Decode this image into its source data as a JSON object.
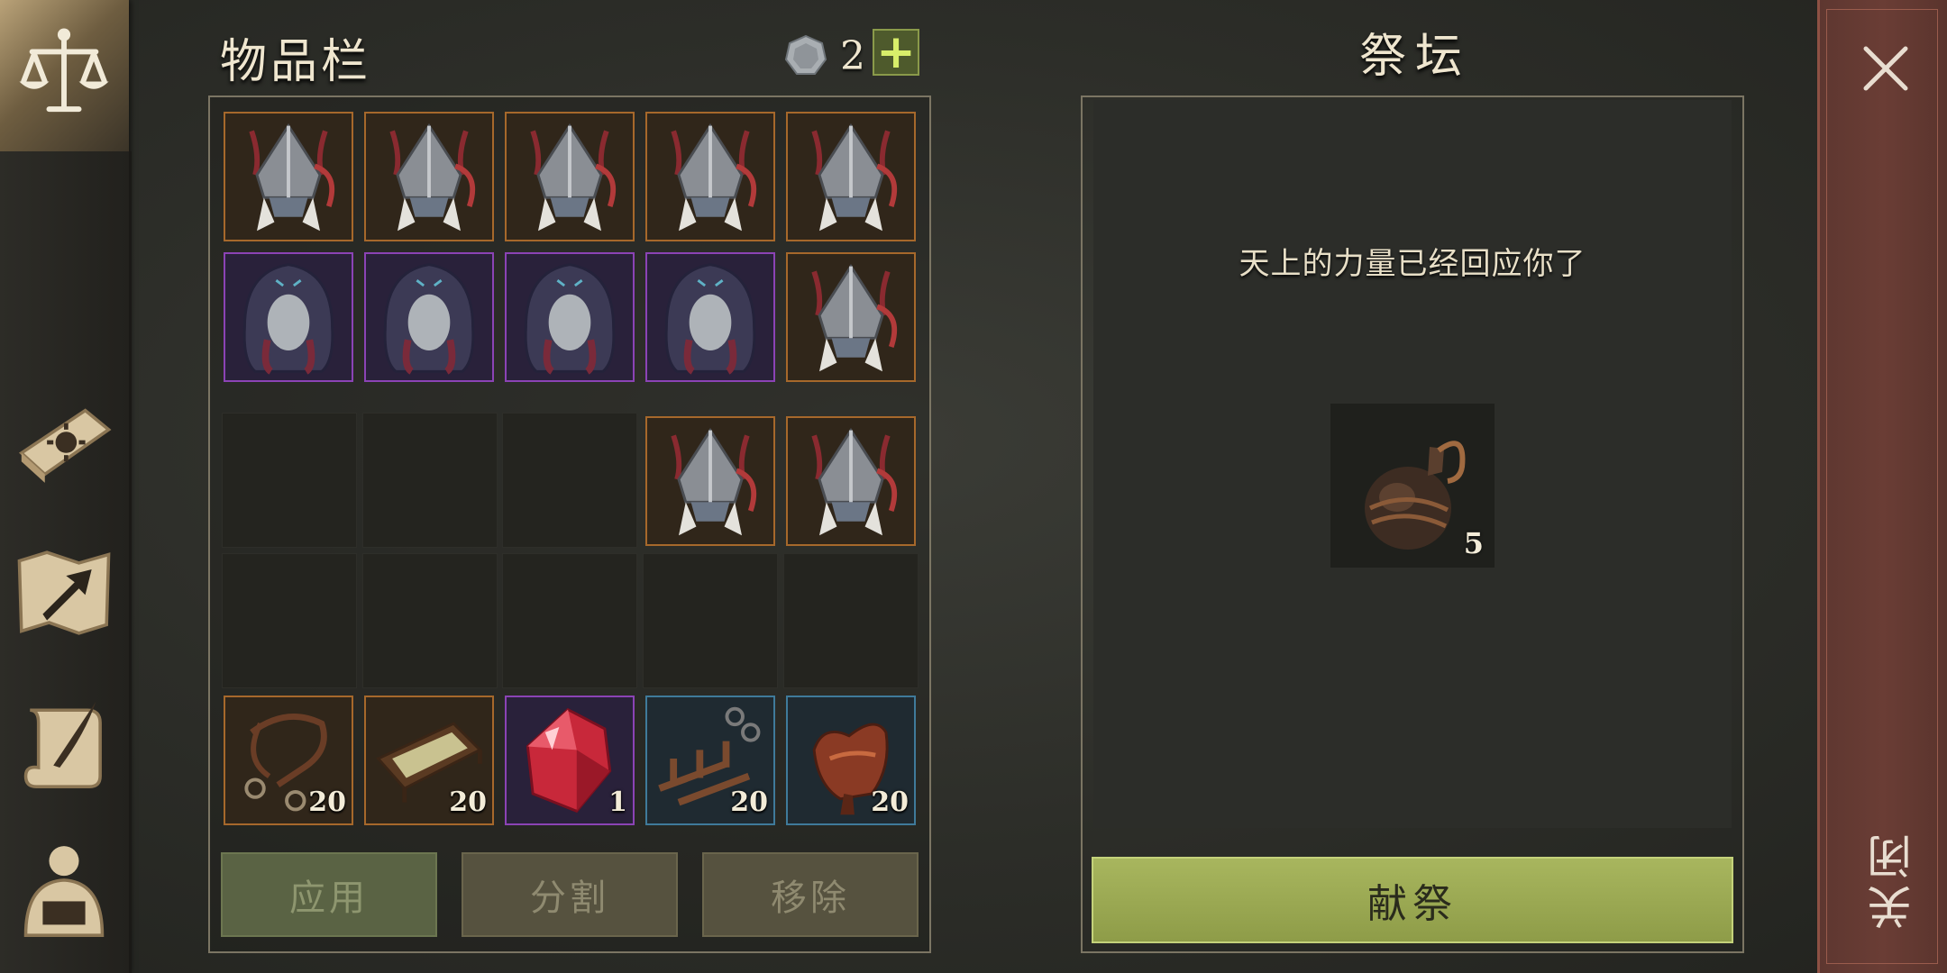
{
  "inventory": {
    "title": "物品栏",
    "currency_count": "2",
    "rows": [
      [
        {
          "item": "helmet-icon",
          "rarity": "orange"
        },
        {
          "item": "helmet-icon",
          "rarity": "orange"
        },
        {
          "item": "helmet-icon",
          "rarity": "orange"
        },
        {
          "item": "helmet-icon",
          "rarity": "orange"
        },
        {
          "item": "helmet-icon",
          "rarity": "orange"
        }
      ],
      [
        {
          "item": "hood-icon",
          "rarity": "purple"
        },
        {
          "item": "hood-icon",
          "rarity": "purple"
        },
        {
          "item": "hood-icon",
          "rarity": "purple"
        },
        {
          "item": "hood-icon",
          "rarity": "purple"
        },
        {
          "item": "helmet-icon",
          "rarity": "orange"
        }
      ],
      [
        {
          "item": "",
          "rarity": "empty"
        },
        {
          "item": "",
          "rarity": "empty"
        },
        {
          "item": "",
          "rarity": "empty"
        },
        {
          "item": "helmet-icon",
          "rarity": "orange"
        },
        {
          "item": "helmet-icon",
          "rarity": "orange"
        }
      ],
      [
        {
          "item": "",
          "rarity": "empty"
        },
        {
          "item": "",
          "rarity": "empty"
        },
        {
          "item": "",
          "rarity": "empty"
        },
        {
          "item": "",
          "rarity": "empty"
        },
        {
          "item": "",
          "rarity": "empty"
        }
      ],
      [
        {
          "item": "bridle-icon",
          "rarity": "orange",
          "count": "20"
        },
        {
          "item": "tray-icon",
          "rarity": "orange",
          "count": "20"
        },
        {
          "item": "ruby-icon",
          "rarity": "purple",
          "count": "1"
        },
        {
          "item": "rack-icon",
          "rarity": "blue",
          "count": "20"
        },
        {
          "item": "saddle-icon",
          "rarity": "blue",
          "count": "20"
        }
      ]
    ],
    "buttons": {
      "apply": "应用",
      "split": "分割",
      "remove": "移除"
    }
  },
  "altar": {
    "title": "祭坛",
    "message": "天上的力量已经回应你了",
    "offering": {
      "item": "jug-icon",
      "count": "5"
    },
    "sacrifice_label": "献祭"
  },
  "close": {
    "label": "关闭"
  },
  "sidebar": [
    "scales-icon",
    "sun-book-icon",
    "map-arrow-icon",
    "scroll-quill-icon",
    "backpack-icon"
  ],
  "colors": {
    "orange": "#a6682b",
    "purple": "#8b43b5",
    "blue": "#3f7a9a",
    "accent_green": "#a8b65e",
    "close_panel": "#6a3d35"
  }
}
